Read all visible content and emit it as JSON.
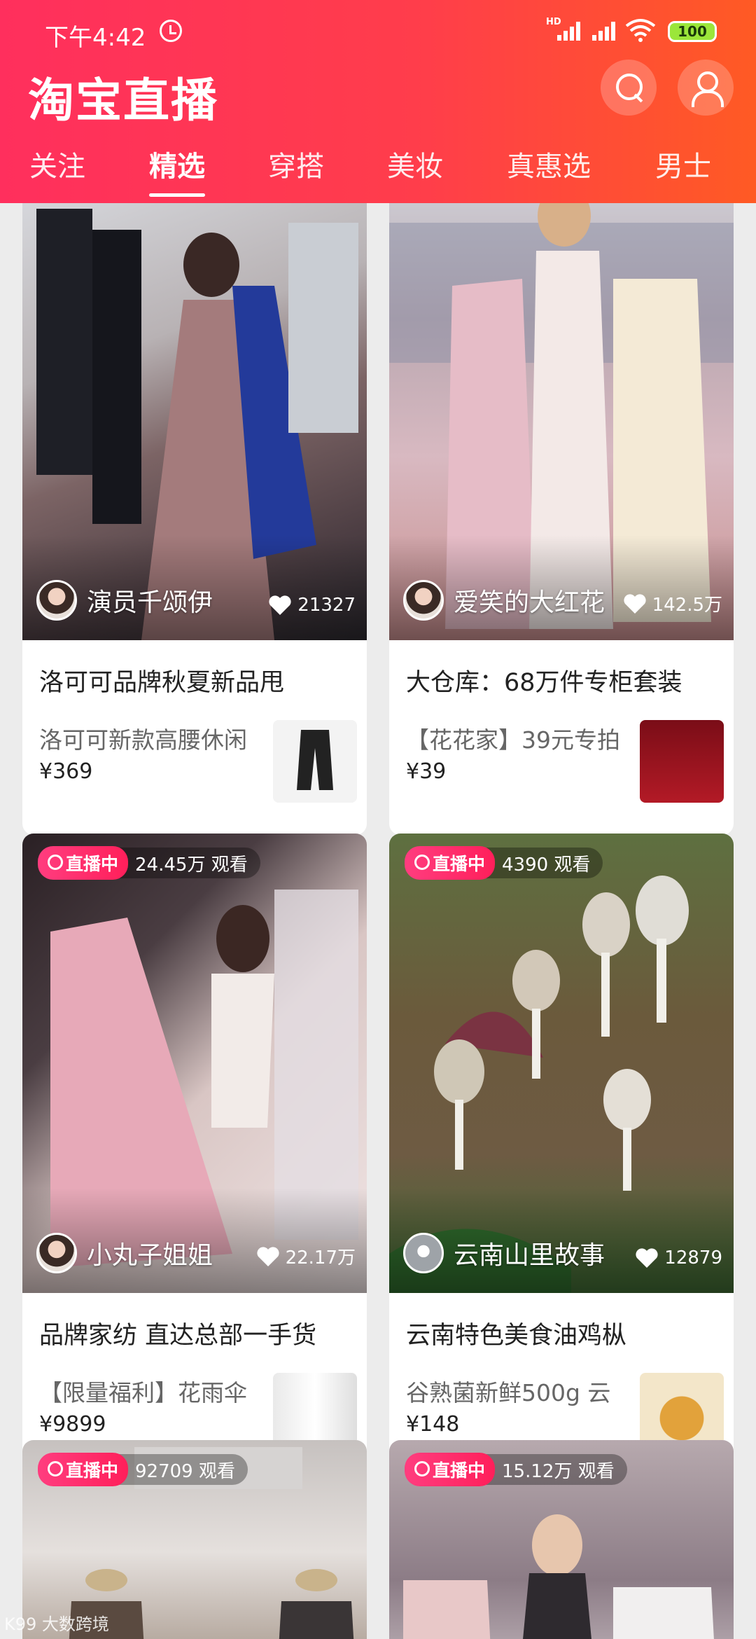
{
  "status_bar": {
    "time": "下午4:42",
    "network": "HD",
    "battery": "100"
  },
  "header": {
    "logo": "淘宝直播",
    "tabs": [
      {
        "label": "关注",
        "active": false
      },
      {
        "label": "精选",
        "active": true
      },
      {
        "label": "穿搭",
        "active": false
      },
      {
        "label": "美妆",
        "active": false
      },
      {
        "label": "真惠选",
        "active": false
      },
      {
        "label": "男士",
        "active": false
      }
    ]
  },
  "feed": {
    "cards": [
      {
        "anchor": "演员千颂伊",
        "likes": "21327",
        "live": false,
        "title": "洛可可品牌秋夏新品甩",
        "product_title": "洛可可新款高腰休闲",
        "price": "¥369"
      },
      {
        "anchor": "爱笑的大红花",
        "likes": "142.5万",
        "live": false,
        "title": "大仓库：68万件专柜套装",
        "product_title": "【花花家】39元专拍",
        "price": "¥39"
      },
      {
        "anchor": "小丸子姐姐",
        "likes": "22.17万",
        "live": true,
        "live_label": "直播中",
        "viewers": "24.45万 观看",
        "title": "品牌家纺 直达总部一手货",
        "product_title": "【限量福利】花雨伞",
        "price": "¥9899"
      },
      {
        "anchor": "云南山里故事",
        "likes": "12879",
        "live": true,
        "live_label": "直播中",
        "viewers": "4390 观看",
        "title": "云南特色美食油鸡枞",
        "product_title": "谷熟菌新鲜500g 云",
        "price": "¥148"
      },
      {
        "live": true,
        "live_label": "直播中",
        "viewers": "92709 观看"
      },
      {
        "live": true,
        "live_label": "直播中",
        "viewers": "15.12万 观看"
      }
    ]
  },
  "watermark": "K99 大数跨境",
  "colors": {
    "header_start": "#ff2f5d",
    "header_end": "#ff5a24",
    "live_tag": "#ff1f5a"
  }
}
